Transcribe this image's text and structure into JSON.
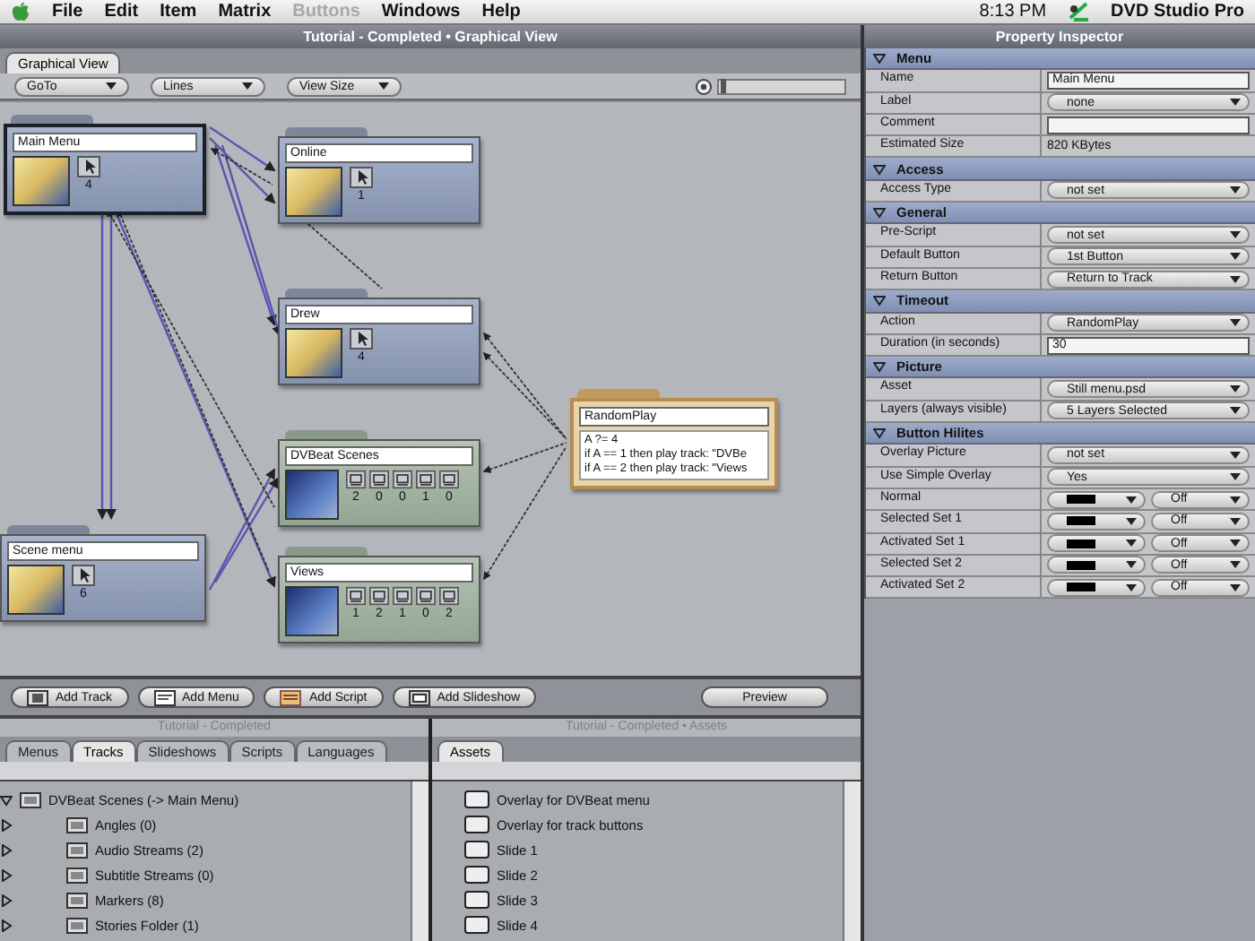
{
  "menubar": {
    "items": [
      {
        "label": "File",
        "disabled": false
      },
      {
        "label": "Edit",
        "disabled": false
      },
      {
        "label": "Item",
        "disabled": false
      },
      {
        "label": "Matrix",
        "disabled": false
      },
      {
        "label": "Buttons",
        "disabled": true
      },
      {
        "label": "Windows",
        "disabled": false
      },
      {
        "label": "Help",
        "disabled": false
      }
    ],
    "clock": "8:13 PM",
    "app_name": "DVD Studio Pro"
  },
  "graph_window": {
    "title": "Tutorial - Completed • Graphical View",
    "tabs": [
      {
        "label": "Graphical View",
        "selected": true
      }
    ],
    "toolbar": {
      "dropdowns": [
        "GoTo",
        "Lines",
        "View Size"
      ],
      "zoom_slider": {
        "level": 0.02
      }
    },
    "nodes": [
      {
        "kind": "menu",
        "title": "Main Menu",
        "count": "4",
        "selected": true
      },
      {
        "kind": "menu",
        "title": "Online",
        "count": "1",
        "selected": false
      },
      {
        "kind": "menu",
        "title": "Drew",
        "count": "4",
        "selected": false
      },
      {
        "kind": "script",
        "title": "RandomPlay",
        "lines": [
          "A ?= 4",
          "if A == 1 then play track: \"DVBe",
          "if A == 2 then play track: \"Views"
        ],
        "selected": false
      },
      {
        "kind": "track",
        "title": "DVBeat Scenes",
        "counts": [
          "2",
          "0",
          "0",
          "1",
          "0"
        ],
        "selected": false
      },
      {
        "kind": "menu",
        "title": "Scene menu",
        "count": "6",
        "selected": false
      },
      {
        "kind": "track",
        "title": "Views",
        "counts": [
          "1",
          "2",
          "1",
          "0",
          "2"
        ],
        "selected": false
      }
    ],
    "buttons": [
      {
        "kind": "track",
        "label": "Add Track"
      },
      {
        "kind": "menu",
        "label": "Add Menu"
      },
      {
        "kind": "script",
        "label": "Add Script"
      },
      {
        "kind": "slideshow",
        "label": "Add Slideshow"
      },
      {
        "kind": "plain",
        "label": "Preview"
      }
    ]
  },
  "tracks_panel": {
    "title": "Tutorial - Completed",
    "tabs": [
      {
        "label": "Menus",
        "selected": false
      },
      {
        "label": "Tracks",
        "selected": true
      },
      {
        "label": "Slideshows",
        "selected": false
      },
      {
        "label": "Scripts",
        "selected": false
      },
      {
        "label": "Languages",
        "selected": false
      }
    ],
    "tree": [
      {
        "label": "DVBeat Scenes (-> Main Menu)",
        "expanded": true,
        "children": [
          {
            "label": "Angles (0)",
            "expanded": false
          },
          {
            "label": "Audio Streams (2)",
            "expanded": false
          },
          {
            "label": "Subtitle Streams (0)",
            "expanded": false
          },
          {
            "label": "Markers (8)",
            "expanded": false
          },
          {
            "label": "Stories Folder (1)",
            "expanded": false
          }
        ]
      }
    ]
  },
  "assets_panel": {
    "title": "Tutorial - Completed • Assets",
    "tabs": [
      {
        "label": "Assets",
        "selected": true
      }
    ],
    "items": [
      "Overlay for DVBeat menu",
      "Overlay for track buttons",
      "Slide 1",
      "Slide 2",
      "Slide 3",
      "Slide 4"
    ]
  },
  "property_inspector": {
    "title": "Property Inspector",
    "sections": [
      {
        "title": "Menu",
        "expanded": true,
        "rows": [
          {
            "kind": "field",
            "label": "Name",
            "value": "Main Menu"
          },
          {
            "kind": "dropdown",
            "label": "Label",
            "value": "none"
          },
          {
            "kind": "field",
            "label": "Comment"
          },
          {
            "kind": "text",
            "label": "Estimated Size",
            "value": "820 KBytes"
          }
        ]
      },
      {
        "title": "Access",
        "expanded": true,
        "rows": [
          {
            "kind": "dropdown",
            "label": "Access Type",
            "value": "not set"
          }
        ]
      },
      {
        "title": "General",
        "expanded": true,
        "rows": [
          {
            "kind": "dropdown",
            "label": "Pre-Script",
            "value": "not set"
          },
          {
            "kind": "dropdown",
            "label": "Default Button",
            "value": "1st Button"
          },
          {
            "kind": "dropdown",
            "label": "Return Button",
            "value": "Return to Track"
          }
        ]
      },
      {
        "title": "Timeout",
        "expanded": true,
        "rows": [
          {
            "kind": "dropdown",
            "label": "Action",
            "value": "RandomPlay"
          },
          {
            "kind": "field",
            "label": "Duration (in seconds)",
            "value": "30"
          }
        ]
      },
      {
        "title": "Picture",
        "expanded": true,
        "rows": [
          {
            "kind": "dropdown",
            "label": "Asset",
            "value": "Still menu.psd"
          },
          {
            "kind": "dropdown",
            "label": "Layers (always visible)",
            "value": "5 Layers Selected"
          }
        ]
      },
      {
        "title": "Button Hilites",
        "expanded": true,
        "rows": [
          {
            "kind": "dropdown",
            "label": "Overlay Picture",
            "value": "not set"
          },
          {
            "kind": "dropdown",
            "label": "Use Simple Overlay",
            "value": "Yes"
          },
          {
            "kind": "color",
            "label": "Normal",
            "color": "#000000",
            "value": "Off"
          },
          {
            "kind": "color",
            "label": "Selected Set 1",
            "color": "#000000",
            "value": "Off"
          },
          {
            "kind": "color",
            "label": "Activated Set 1",
            "color": "#000000",
            "value": "Off"
          },
          {
            "kind": "color",
            "label": "Selected Set 2",
            "color": "#000000",
            "value": "Off"
          },
          {
            "kind": "color",
            "label": "Activated Set 2",
            "color": "#000000",
            "value": "Off"
          }
        ]
      }
    ]
  }
}
